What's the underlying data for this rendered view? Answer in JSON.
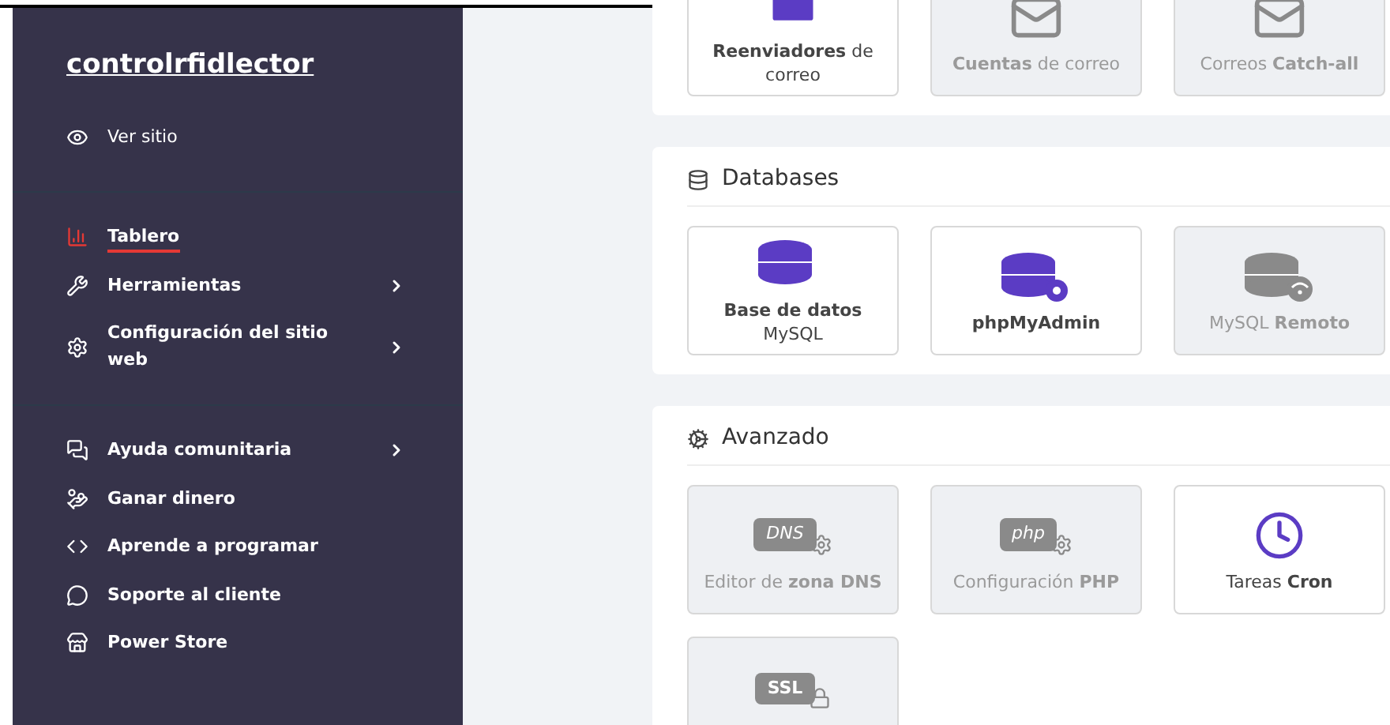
{
  "sidebar": {
    "site_name": "controlrfidlector",
    "view_site": "Ver sitio",
    "sections": [
      {
        "items": [
          {
            "label": "Tablero",
            "selected": true,
            "submenu": false
          },
          {
            "label": "Herramientas",
            "selected": false,
            "submenu": true
          },
          {
            "label": "Configuración del sitio web",
            "selected": false,
            "submenu": true
          }
        ]
      },
      {
        "items": [
          {
            "label": "Ayuda comunitaria",
            "selected": false,
            "submenu": true
          },
          {
            "label": "Ganar dinero",
            "selected": false,
            "submenu": false
          },
          {
            "label": "Aprende a programar",
            "selected": false,
            "submenu": false
          },
          {
            "label": "Soporte al cliente",
            "selected": false,
            "submenu": false
          },
          {
            "label": "Power Store",
            "selected": false,
            "submenu": false
          }
        ]
      }
    ]
  },
  "sections": [
    {
      "tiles": [
        {
          "label": "**Reenviadores** de correo",
          "disabled": false
        },
        {
          "label": "**Cuentas** de correo",
          "disabled": true
        },
        {
          "label": "Correos **Catch-all**",
          "disabled": true
        }
      ]
    },
    {
      "title": "Databases",
      "tiles": [
        {
          "label": "**Base de datos** MySQL",
          "disabled": false
        },
        {
          "label": "phpMyAdmin",
          "disabled": false,
          "bold": true
        },
        {
          "label": "MySQL **Remoto**",
          "disabled": true
        }
      ]
    },
    {
      "title": "Avanzado",
      "tiles": [
        {
          "badge": "DNS",
          "label": "Editor de **zona DNS**",
          "disabled": true
        },
        {
          "badge": "php",
          "label": "Configuración **PHP**",
          "disabled": true
        },
        {
          "label": "Tareas **Cron**",
          "disabled": false
        },
        {
          "badge": "SSL",
          "disabled": true
        }
      ]
    }
  ]
}
